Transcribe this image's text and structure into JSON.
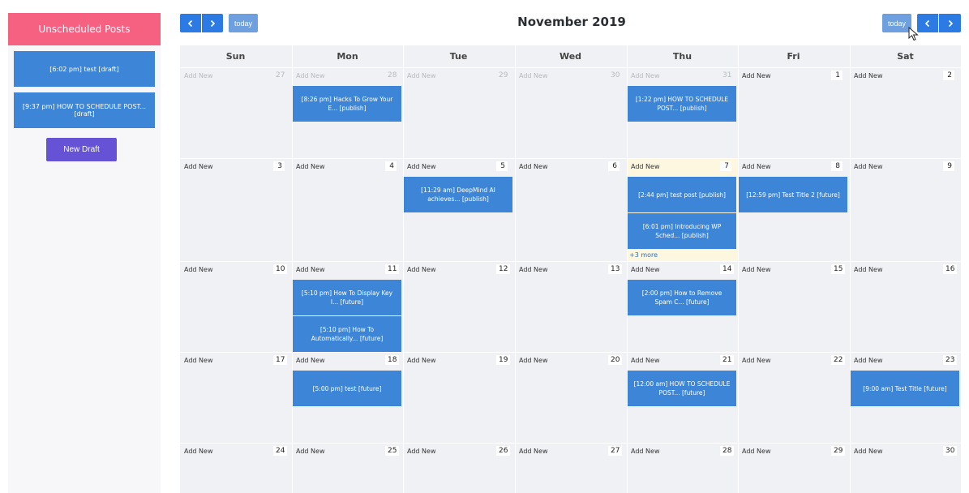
{
  "sidebar": {
    "title": "Unscheduled Posts",
    "drafts": [
      {
        "label": "[6:02 pm] test [draft]"
      },
      {
        "label": "[9:37 pm] HOW TO SCHEDULE POST... [draft]"
      }
    ],
    "new_draft_label": "New Draft"
  },
  "toolbar": {
    "today_label": "today",
    "title": "November 2019"
  },
  "colors": {
    "accent": "#2c7be5",
    "event": "#3d86d7",
    "unscheduled_header": "#f66182",
    "new_draft": "#6552d4",
    "today_highlight": "#fdf7e0"
  },
  "calendar": {
    "weekdays": [
      "Sun",
      "Mon",
      "Tue",
      "Wed",
      "Thu",
      "Fri",
      "Sat"
    ],
    "add_new_label": "Add New",
    "weeks": [
      [
        "27",
        "28",
        "29",
        "30",
        "31",
        "1",
        "2"
      ],
      [
        "3",
        "4",
        "5",
        "6",
        "7",
        "8",
        "9"
      ],
      [
        "10",
        "11",
        "12",
        "13",
        "14",
        "15",
        "16"
      ],
      [
        "17",
        "18",
        "19",
        "20",
        "21",
        "22",
        "23"
      ],
      [
        "24",
        "25",
        "26",
        "27",
        "28",
        "29",
        "30"
      ]
    ],
    "events": [
      {
        "week": 0,
        "day": 1,
        "slot": 0,
        "label": "[8:26 pm] Hacks To Grow Your E... [publish]"
      },
      {
        "week": 0,
        "day": 4,
        "slot": 0,
        "label": "[1:22 pm] HOW TO SCHEDULE POST... [publish]"
      },
      {
        "week": 1,
        "day": 2,
        "slot": 0,
        "label": "[11:29 am] DeepMind AI achieves... [publish]"
      },
      {
        "week": 1,
        "day": 4,
        "slot": 0,
        "label": "[2:44 pm] test post [publish]"
      },
      {
        "week": 1,
        "day": 4,
        "slot": 1,
        "label": "[6:01 pm] Introducing WP Sched... [publish]"
      },
      {
        "week": 1,
        "day": 5,
        "slot": 0,
        "label": "[12:59 pm] Test Title 2 [future]"
      },
      {
        "week": 2,
        "day": 1,
        "slot": 0,
        "label": "[5:10 pm] How To Display Key I... [future]"
      },
      {
        "week": 2,
        "day": 1,
        "slot": 1,
        "label": "[5:10 pm] How To Automatically... [future]"
      },
      {
        "week": 2,
        "day": 4,
        "slot": 0,
        "label": "[2:00 pm] How to Remove Spam C... [future]"
      },
      {
        "week": 3,
        "day": 1,
        "slot": 0,
        "label": "[5:00 pm] test [future]"
      },
      {
        "week": 3,
        "day": 4,
        "slot": 0,
        "label": "[12:00 am] HOW TO SCHEDULE POST... [future]"
      },
      {
        "week": 3,
        "day": 6,
        "slot": 0,
        "label": "[9:00 am] Test Title [future]"
      }
    ],
    "more": [
      {
        "week": 1,
        "day": 4,
        "label": "+3 more"
      }
    ]
  }
}
